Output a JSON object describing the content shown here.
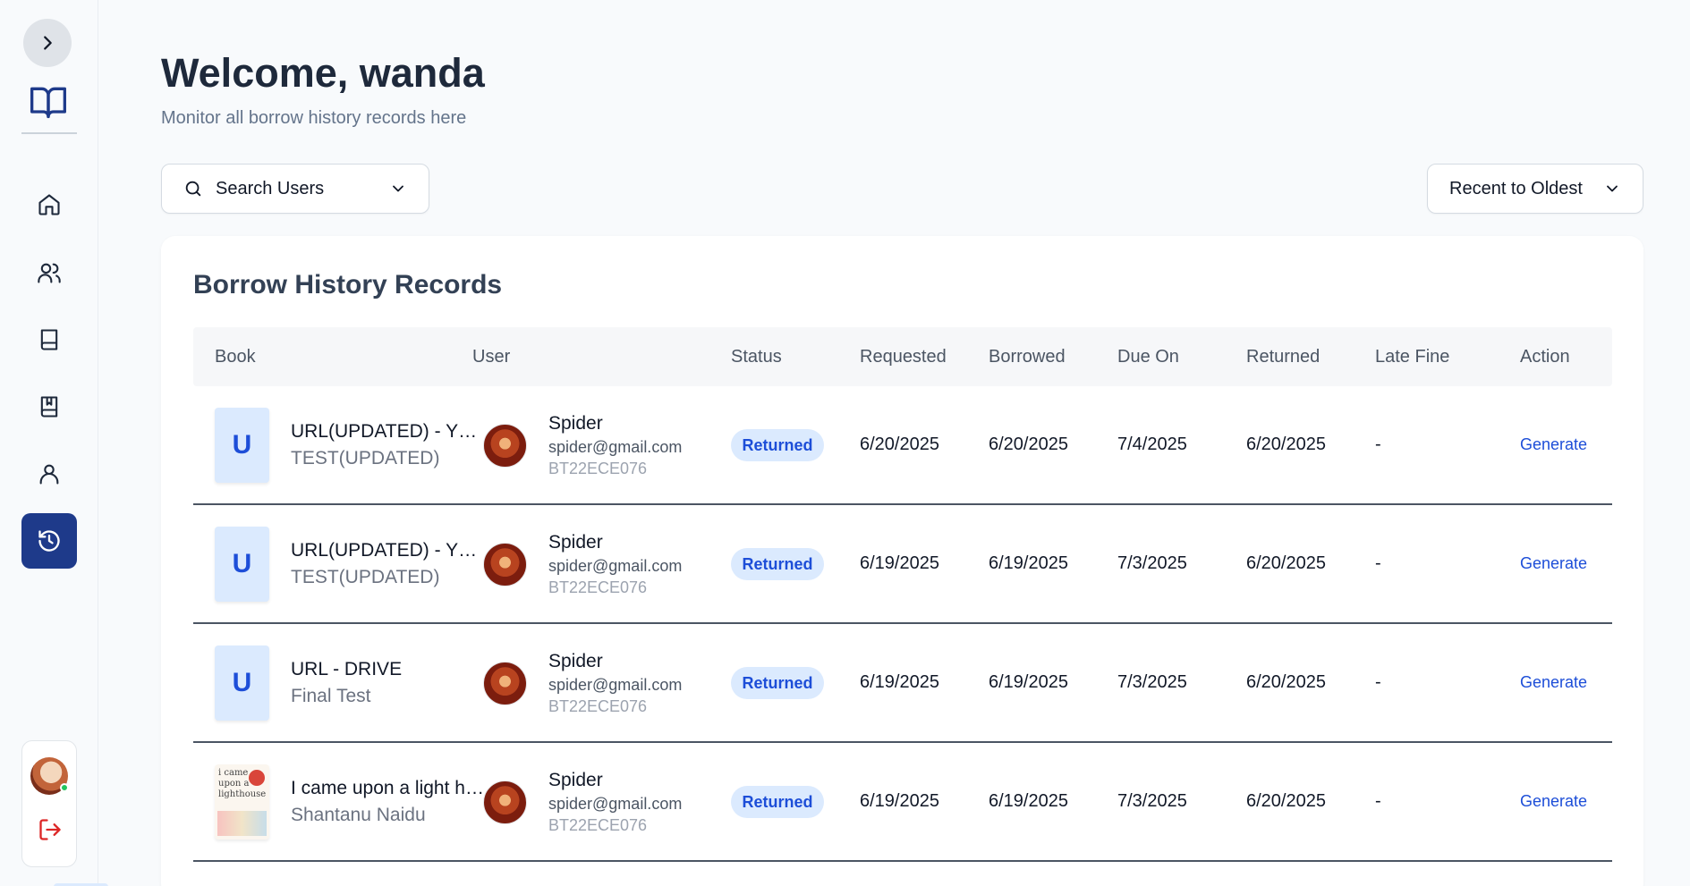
{
  "header": {
    "title": "Welcome, wanda",
    "subtitle": "Monitor all borrow history records here"
  },
  "search": {
    "label": "Search Users"
  },
  "sort": {
    "label": "Recent to Oldest"
  },
  "card": {
    "title": "Borrow History Records"
  },
  "columns": [
    "Book",
    "User",
    "Status",
    "Requested",
    "Borrowed",
    "Due On",
    "Returned",
    "Late Fine",
    "Action"
  ],
  "rows": [
    {
      "thumb_letter": "U",
      "book_title": "URL(UPDATED) - YOUTUBE",
      "book_author": "TEST(UPDATED)",
      "user_name": "Spider",
      "user_email": "spider@gmail.com",
      "user_id": "BT22ECE076",
      "status": "Returned",
      "requested": "6/20/2025",
      "borrowed": "6/20/2025",
      "due_on": "7/4/2025",
      "returned": "6/20/2025",
      "late_fine": "-",
      "action": "Generate"
    },
    {
      "thumb_letter": "U",
      "book_title": "URL(UPDATED) - YOUTUBE",
      "book_author": "TEST(UPDATED)",
      "user_name": "Spider",
      "user_email": "spider@gmail.com",
      "user_id": "BT22ECE076",
      "status": "Returned",
      "requested": "6/19/2025",
      "borrowed": "6/19/2025",
      "due_on": "7/3/2025",
      "returned": "6/20/2025",
      "late_fine": "-",
      "action": "Generate"
    },
    {
      "thumb_letter": "U",
      "book_title": "URL - DRIVE",
      "book_author": "Final Test",
      "user_name": "Spider",
      "user_email": "spider@gmail.com",
      "user_id": "BT22ECE076",
      "status": "Returned",
      "requested": "6/19/2025",
      "borrowed": "6/19/2025",
      "due_on": "7/3/2025",
      "returned": "6/20/2025",
      "late_fine": "-",
      "action": "Generate"
    },
    {
      "cover_text": "i came upon a lighthouse",
      "book_title": "I came upon a light house",
      "book_author": "Shantanu Naidu",
      "user_name": "Spider",
      "user_email": "spider@gmail.com",
      "user_id": "BT22ECE076",
      "status": "Returned",
      "requested": "6/19/2025",
      "borrowed": "6/19/2025",
      "due_on": "7/3/2025",
      "returned": "6/20/2025",
      "late_fine": "-",
      "action": "Generate"
    }
  ],
  "colors": {
    "accent": "#1e3a8a",
    "badge_bg": "#dbeafe",
    "badge_text": "#1d4ed8",
    "logout": "#dc2626",
    "online": "#22c55e"
  },
  "sidebar_icons": [
    "chevron-right-icon",
    "open-book-icon",
    "home-icon",
    "users-icon",
    "book-icon",
    "bookmark-book-icon",
    "user-icon",
    "history-icon",
    "logout-icon"
  ]
}
